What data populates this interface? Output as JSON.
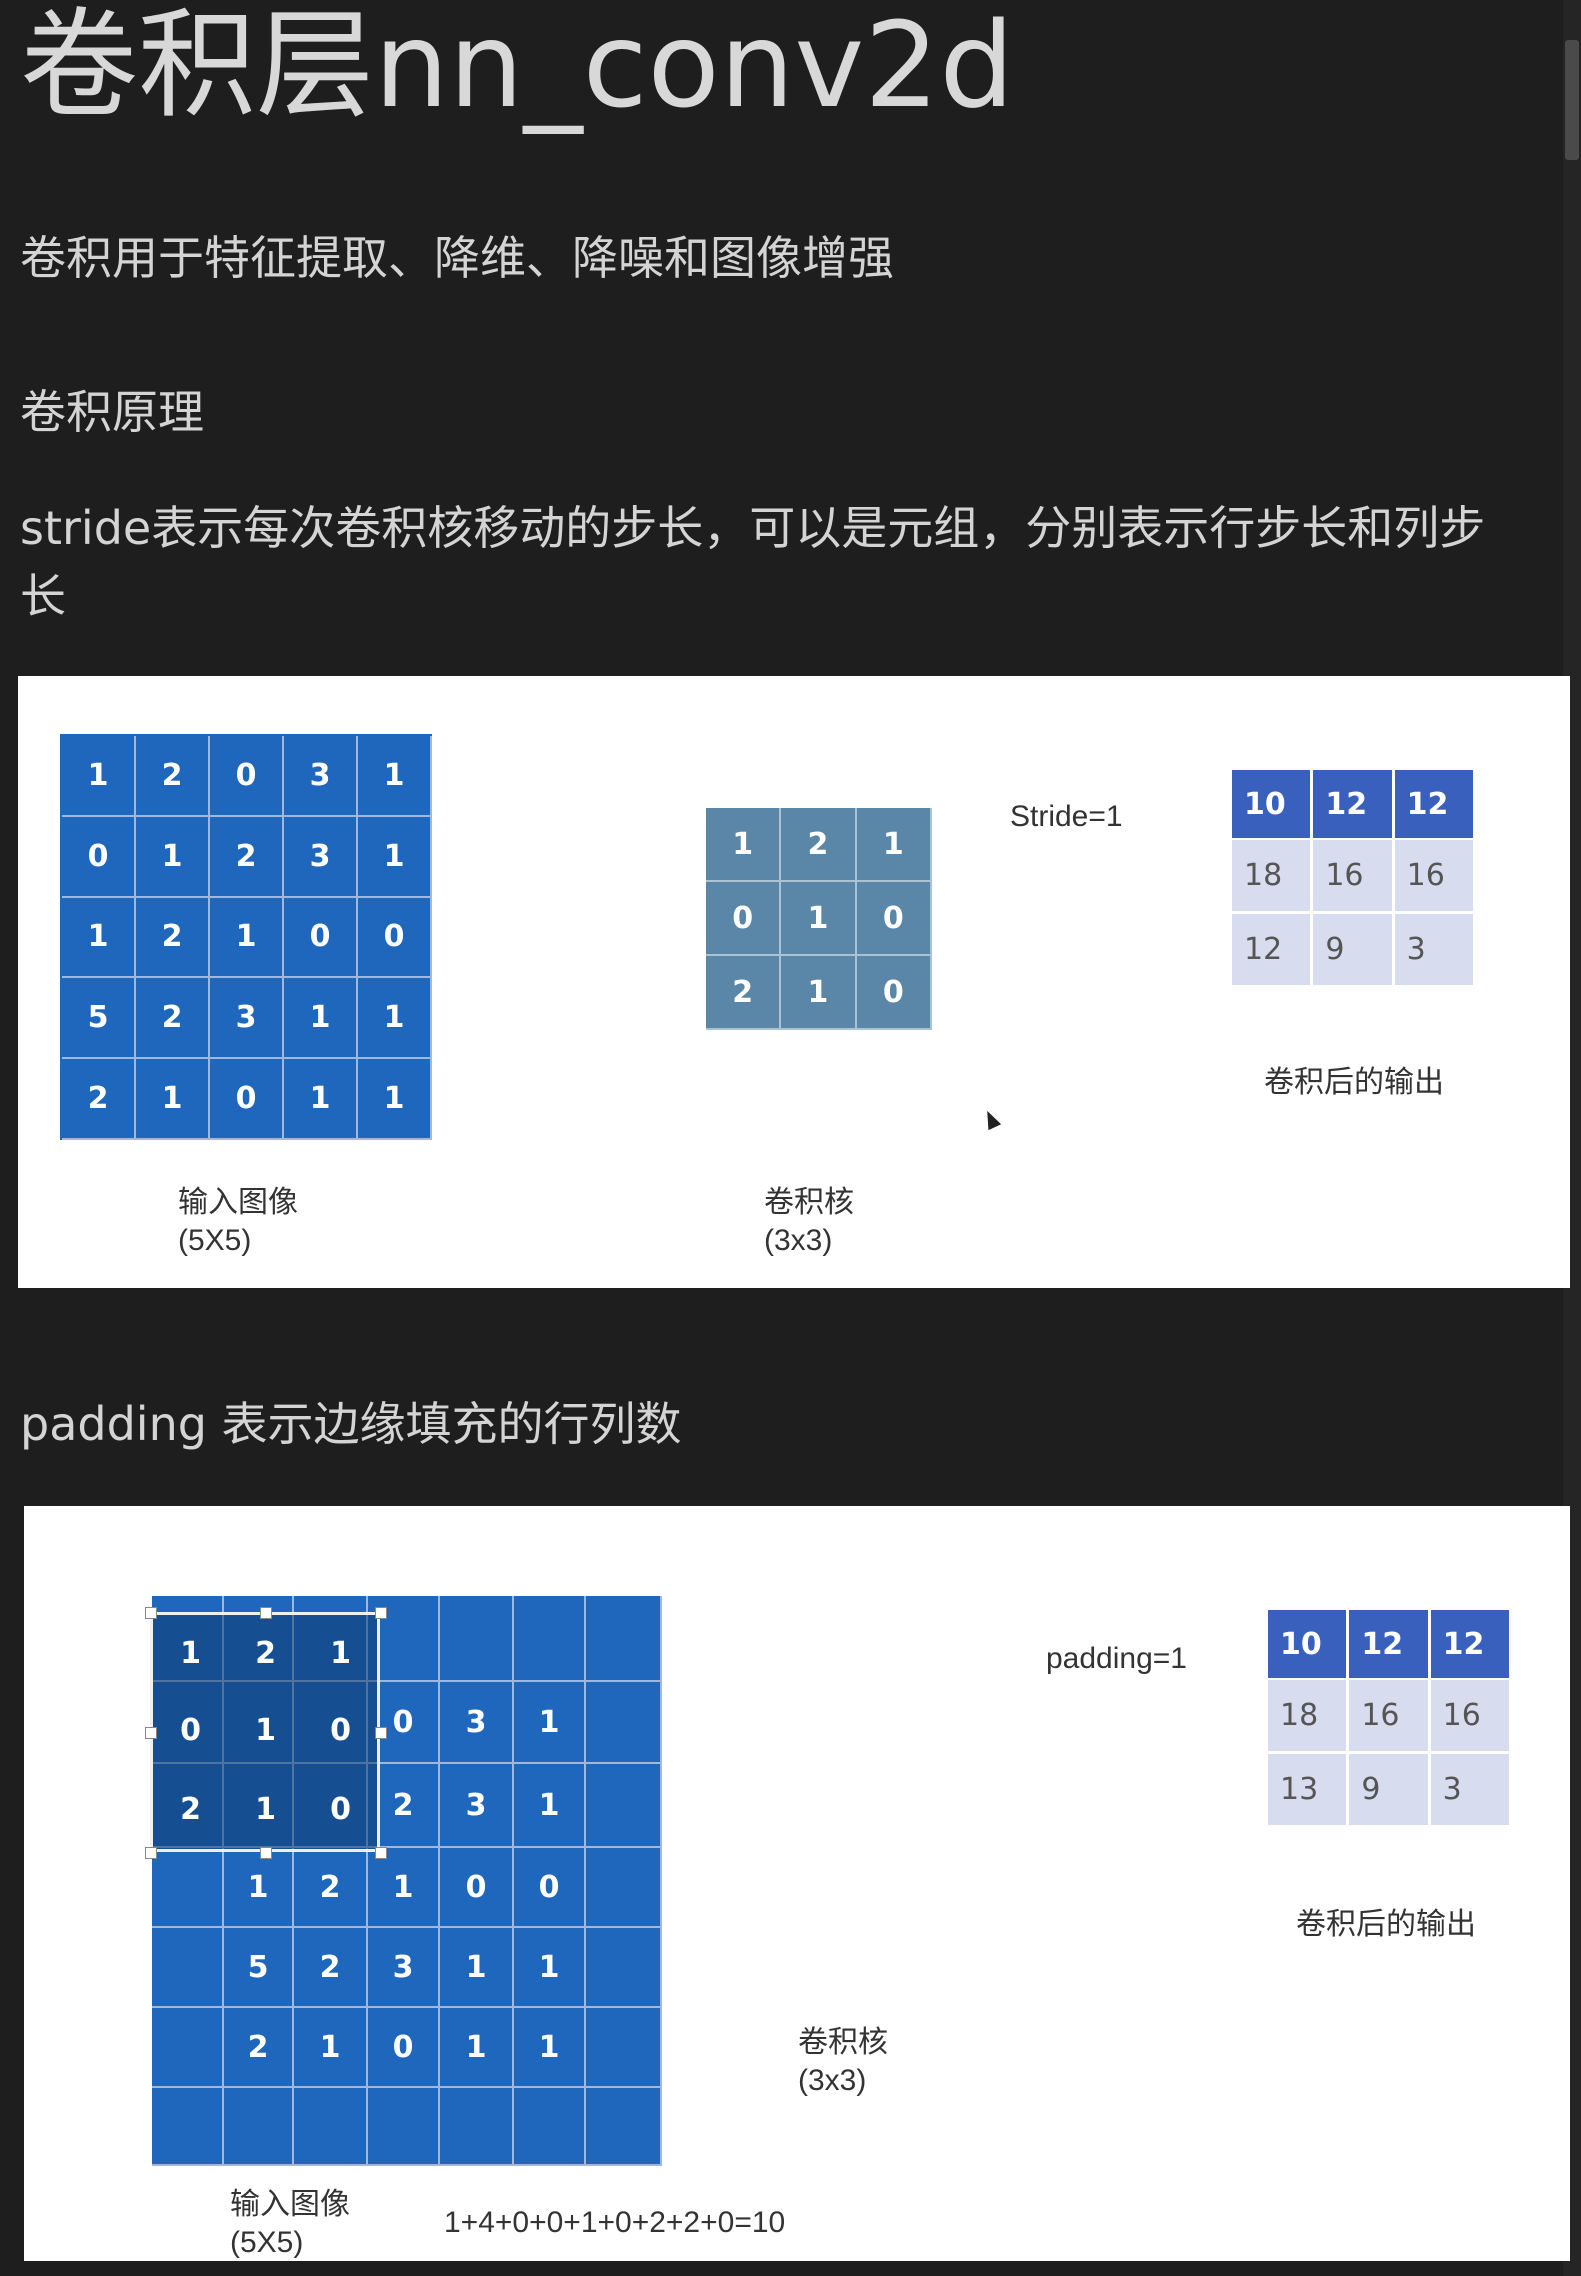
{
  "title": "卷积层nn_conv2d",
  "paragraphs": {
    "intro": "卷积用于特征提取、降维、降噪和图像增强",
    "principle": "卷积原理",
    "stride_line1": "stride表示每次卷积核移动的步长，可以是元组，分别表示行步长和列步",
    "stride_line2": "长",
    "padding": "padding 表示边缘填充的行列数"
  },
  "figure1": {
    "input_matrix": [
      [
        1,
        2,
        0,
        3,
        1
      ],
      [
        0,
        1,
        2,
        3,
        1
      ],
      [
        1,
        2,
        1,
        0,
        0
      ],
      [
        5,
        2,
        3,
        1,
        1
      ],
      [
        2,
        1,
        0,
        1,
        1
      ]
    ],
    "input_label": "输入图像",
    "input_size": "(5X5)",
    "kernel_matrix": [
      [
        1,
        2,
        1
      ],
      [
        0,
        1,
        0
      ],
      [
        2,
        1,
        0
      ]
    ],
    "kernel_label": "卷积核",
    "kernel_size": "(3x3)",
    "param": "Stride=1",
    "output_matrix": [
      [
        10,
        12,
        12
      ],
      [
        18,
        16,
        16
      ],
      [
        12,
        9,
        3
      ]
    ],
    "output_label": "卷积后的输出"
  },
  "figure2": {
    "padded_input": [
      [
        "",
        "",
        "",
        "",
        "",
        "",
        ""
      ],
      [
        "",
        "",
        1,
        2,
        0,
        3,
        1,
        ""
      ],
      [
        "",
        "",
        0,
        1,
        2,
        3,
        1,
        ""
      ],
      [
        "",
        1,
        2,
        1,
        0,
        0,
        ""
      ],
      [
        "",
        5,
        2,
        3,
        1,
        1,
        ""
      ],
      [
        "",
        2,
        1,
        0,
        1,
        1,
        ""
      ],
      [
        "",
        "",
        "",
        "",
        "",
        "",
        ""
      ]
    ],
    "kernel_overlay": [
      [
        1,
        2,
        1
      ],
      [
        0,
        1,
        0
      ],
      [
        2,
        1,
        0
      ]
    ],
    "input_label": "输入图像",
    "input_size": "(5X5)",
    "kernel_label": "卷积核",
    "kernel_size": "(3x3)",
    "param": "padding=1",
    "output_matrix": [
      [
        10,
        12,
        12
      ],
      [
        18,
        16,
        16
      ],
      [
        13,
        9,
        3
      ]
    ],
    "output_label": "卷积后的输出",
    "formula": "1+4+0+0+1+0+2+2+0=10"
  },
  "colors": {
    "page_bg": "#1e1e1e",
    "input_blue": "#1f66bd",
    "kernel_blue": "#5a86a8",
    "output_head": "#3a60bd",
    "output_body": "#d7dcee"
  }
}
